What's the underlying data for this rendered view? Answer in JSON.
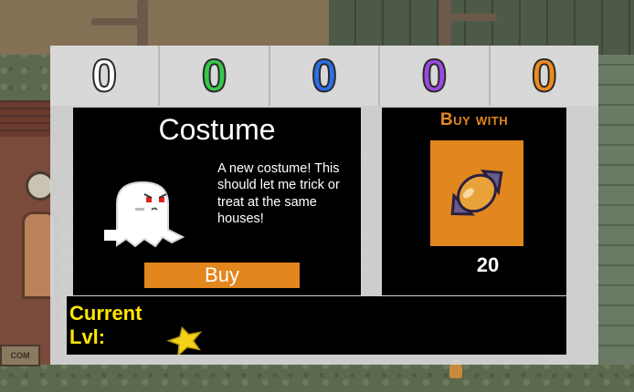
{
  "currencies": [
    {
      "name": "white-candy",
      "value": "0",
      "color": "#ffffff"
    },
    {
      "name": "green-candy",
      "value": "0",
      "color": "#38c84a"
    },
    {
      "name": "blue-candy",
      "value": "0",
      "color": "#2a6ee8"
    },
    {
      "name": "purple-candy",
      "value": "0",
      "color": "#9a4ae0"
    },
    {
      "name": "orange-candy",
      "value": "0",
      "color": "#f08a1e"
    }
  ],
  "item": {
    "title": "Costume",
    "icon": "ghost-costume-icon",
    "description": "A new costume! This should let me trick or treat at the same houses!",
    "buy_label": "Buy"
  },
  "cost": {
    "heading": "Buy with",
    "currency_icon": "orange-candy-icon",
    "amount": "20"
  },
  "level": {
    "label": "Current Lvl:",
    "icon": "star-icon",
    "stars_filled": 1
  },
  "background": {
    "sign_text": "COM",
    "stray_text": "C"
  },
  "colors": {
    "accent": "#e2861e",
    "level_text": "#ffe600",
    "panel_bg": "#d8d8d8"
  }
}
